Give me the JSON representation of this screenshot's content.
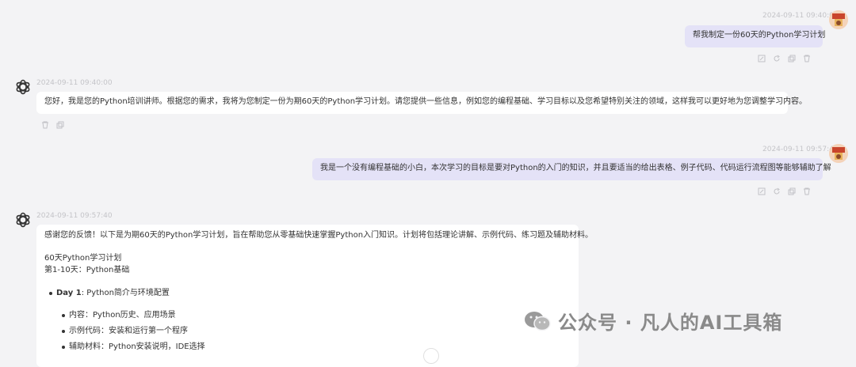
{
  "messages": [
    {
      "role": "user",
      "timestamp": "2024-09-11 09:40:00",
      "text": "帮我制定一份60天的Python学习计划"
    },
    {
      "role": "assistant",
      "timestamp": "2024-09-11 09:40:00",
      "text": "您好，我是您的Python培训讲师。根据您的需求，我将为您制定一份为期60天的Python学习计划。请您提供一些信息，例如您的编程基础、学习目标以及您希望特别关注的领域，这样我可以更好地为您调整学习内容。"
    },
    {
      "role": "user",
      "timestamp": "2024-09-11 09:57:40",
      "text": "我是一个没有编程基础的小白，本次学习的目标是要对Python的入门的知识，并且要适当的给出表格、例子代码、代码运行流程图等能够辅助了解"
    },
    {
      "role": "assistant",
      "timestamp": "2024-09-11 09:57:40",
      "intro": "感谢您的反馈！以下是为期60天的Python学习计划，旨在帮助您从零基础快速掌握Python入门知识。计划将包括理论讲解、示例代码、练习题及辅助材料。",
      "plan_title": "60天Python学习计划",
      "section": "第1-10天：Python基础",
      "day_label": "Day 1",
      "day_title": ": Python简介与环境配置",
      "items": [
        "内容：Python历史、应用场景",
        "示例代码：安装和运行第一个程序",
        "辅助材料：Python安装说明，IDE选择"
      ]
    }
  ],
  "icons": {
    "edit": "edit-icon",
    "refresh": "refresh-icon",
    "copy": "copy-icon",
    "delete": "trash-icon"
  },
  "watermark": {
    "text": "公众号 · 凡人的AI工具箱"
  }
}
